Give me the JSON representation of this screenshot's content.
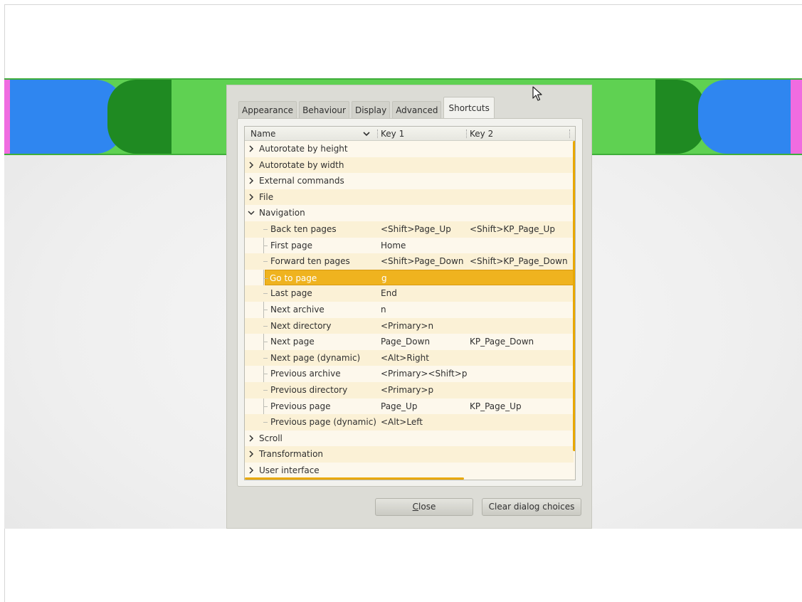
{
  "colors": {
    "banner_green": "#5fd152",
    "banner_dark_green": "#1f8a22",
    "banner_blue": "#2f86f0",
    "banner_pink": "#f06ce0",
    "selection": "#efb31f",
    "scrollbar": "#e9a800"
  },
  "dialog": {
    "tabs": [
      {
        "label": "Appearance"
      },
      {
        "label": "Behaviour"
      },
      {
        "label": "Display"
      },
      {
        "label": "Advanced"
      },
      {
        "label": "Shortcuts"
      }
    ],
    "active_tab": "Shortcuts",
    "columns": {
      "name": "Name",
      "key1": "Key 1",
      "key2": "Key 2",
      "sort_icon": "chevron-down-icon"
    },
    "rows": [
      {
        "name": "Autorotate by height",
        "key1": "",
        "key2": "",
        "level": 0,
        "expander": "collapsed"
      },
      {
        "name": "Autorotate by width",
        "key1": "",
        "key2": "",
        "level": 0,
        "expander": "collapsed"
      },
      {
        "name": "External commands",
        "key1": "",
        "key2": "",
        "level": 0,
        "expander": "collapsed"
      },
      {
        "name": "File",
        "key1": "",
        "key2": "",
        "level": 0,
        "expander": "collapsed"
      },
      {
        "name": "Navigation",
        "key1": "",
        "key2": "",
        "level": 0,
        "expander": "expanded"
      },
      {
        "name": "Back ten pages",
        "key1": "<Shift>Page_Up",
        "key2": "<Shift>KP_Page_Up",
        "level": 1
      },
      {
        "name": "First page",
        "key1": "Home",
        "key2": "",
        "level": 1
      },
      {
        "name": "Forward ten pages",
        "key1": "<Shift>Page_Down",
        "key2": "<Shift>KP_Page_Down",
        "level": 1
      },
      {
        "name": "Go to page",
        "key1": "g",
        "key2": "",
        "level": 1,
        "selected": true
      },
      {
        "name": "Last page",
        "key1": "End",
        "key2": "",
        "level": 1
      },
      {
        "name": "Next archive",
        "key1": "n",
        "key2": "",
        "level": 1
      },
      {
        "name": "Next directory",
        "key1": "<Primary>n",
        "key2": "",
        "level": 1
      },
      {
        "name": "Next page",
        "key1": "Page_Down",
        "key2": "KP_Page_Down",
        "level": 1
      },
      {
        "name": "Next page (dynamic)",
        "key1": "<Alt>Right",
        "key2": "",
        "level": 1
      },
      {
        "name": "Previous archive",
        "key1": "<Primary><Shift>p",
        "key2": "",
        "level": 1
      },
      {
        "name": "Previous directory",
        "key1": "<Primary>p",
        "key2": "",
        "level": 1
      },
      {
        "name": "Previous page",
        "key1": "Page_Up",
        "key2": "KP_Page_Up",
        "level": 1
      },
      {
        "name": "Previous page (dynamic)",
        "key1": "<Alt>Left",
        "key2": "",
        "level": 1
      },
      {
        "name": "Scroll",
        "key1": "",
        "key2": "",
        "level": 0,
        "expander": "collapsed"
      },
      {
        "name": "Transformation",
        "key1": "",
        "key2": "",
        "level": 0,
        "expander": "collapsed"
      },
      {
        "name": "User interface",
        "key1": "",
        "key2": "",
        "level": 0,
        "expander": "collapsed"
      }
    ],
    "buttons": {
      "close_pre": "",
      "close_mnemonic": "C",
      "close_post": "lose",
      "clear": "Clear dialog choices"
    }
  },
  "cursor": {
    "icon": "mouse-pointer-icon"
  }
}
